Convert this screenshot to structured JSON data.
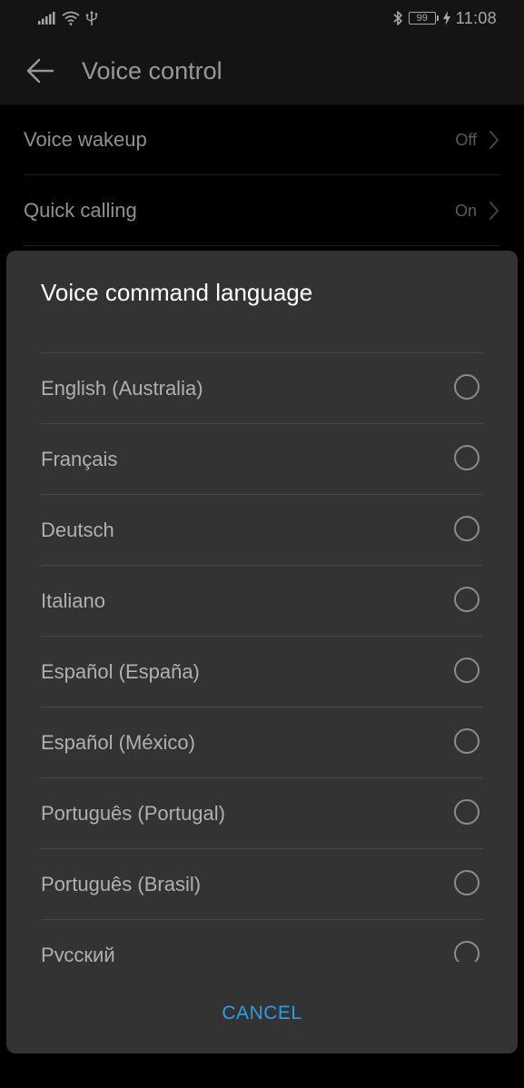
{
  "status_bar": {
    "time": "11:08",
    "battery_level": "99",
    "icons": [
      "signal-icon",
      "wifi-icon",
      "usb-icon",
      "bluetooth-icon",
      "battery-icon",
      "charging-icon"
    ]
  },
  "app_bar": {
    "title": "Voice control",
    "back_icon": "arrow-left-icon"
  },
  "settings": [
    {
      "label": "Voice wakeup",
      "value": "Off"
    },
    {
      "label": "Quick calling",
      "value": "On"
    }
  ],
  "dialog": {
    "title": "Voice command language",
    "options": [
      {
        "label": "English (Australia)",
        "selected": false
      },
      {
        "label": "Français",
        "selected": false
      },
      {
        "label": "Deutsch",
        "selected": false
      },
      {
        "label": "Italiano",
        "selected": false
      },
      {
        "label": "Español (España)",
        "selected": false
      },
      {
        "label": "Español (México)",
        "selected": false
      },
      {
        "label": "Português (Portugal)",
        "selected": false
      },
      {
        "label": "Português (Brasil)",
        "selected": false
      },
      {
        "label": "Русский",
        "selected": false
      }
    ],
    "cancel_label": "CANCEL"
  },
  "colors": {
    "background": "#000000",
    "bar": "#1f1f1f",
    "dialog": "#333333",
    "accent": "#2e9ee6"
  }
}
